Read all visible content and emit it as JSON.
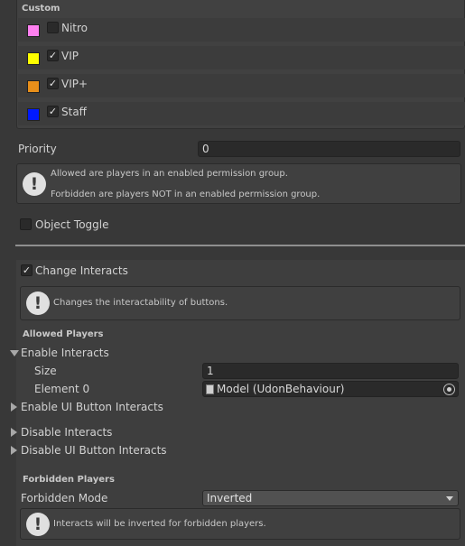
{
  "custom": {
    "title": "Custom",
    "items": [
      {
        "label": "Nitro",
        "checked": false,
        "color": "#ff80f0"
      },
      {
        "label": "VIP",
        "checked": true,
        "color": "#ffff00"
      },
      {
        "label": "VIP+",
        "checked": true,
        "color": "#e88f1a"
      },
      {
        "label": "Staff",
        "checked": true,
        "color": "#0019ff"
      }
    ]
  },
  "priority": {
    "label": "Priority",
    "value": "0"
  },
  "permission_help": {
    "line1": "Allowed are players in an enabled permission group.",
    "line2": "Forbidden are players NOT in an enabled permission group."
  },
  "object_toggle": {
    "label": "Object Toggle",
    "checked": false
  },
  "change_interacts": {
    "label": "Change Interacts",
    "checked": true,
    "help": "Changes the interactability of buttons."
  },
  "allowed": {
    "heading": "Allowed Players",
    "enable_interacts": {
      "label": "Enable Interacts",
      "expanded": true,
      "size_label": "Size",
      "size_value": "1",
      "element_label": "Element 0",
      "element_value": "Model (UdonBehaviour)"
    },
    "enable_ui": "Enable UI Button Interacts",
    "disable_interacts": "Disable Interacts",
    "disable_ui": "Disable UI Button Interacts"
  },
  "forbidden": {
    "heading": "Forbidden Players",
    "mode_label": "Forbidden Mode",
    "mode_value": "Inverted",
    "help": "Interacts will be inverted for forbidden players."
  },
  "icons": {
    "help": "exclamation-icon",
    "check": "✓",
    "object": "script-icon",
    "picker": "object-picker-icon"
  }
}
